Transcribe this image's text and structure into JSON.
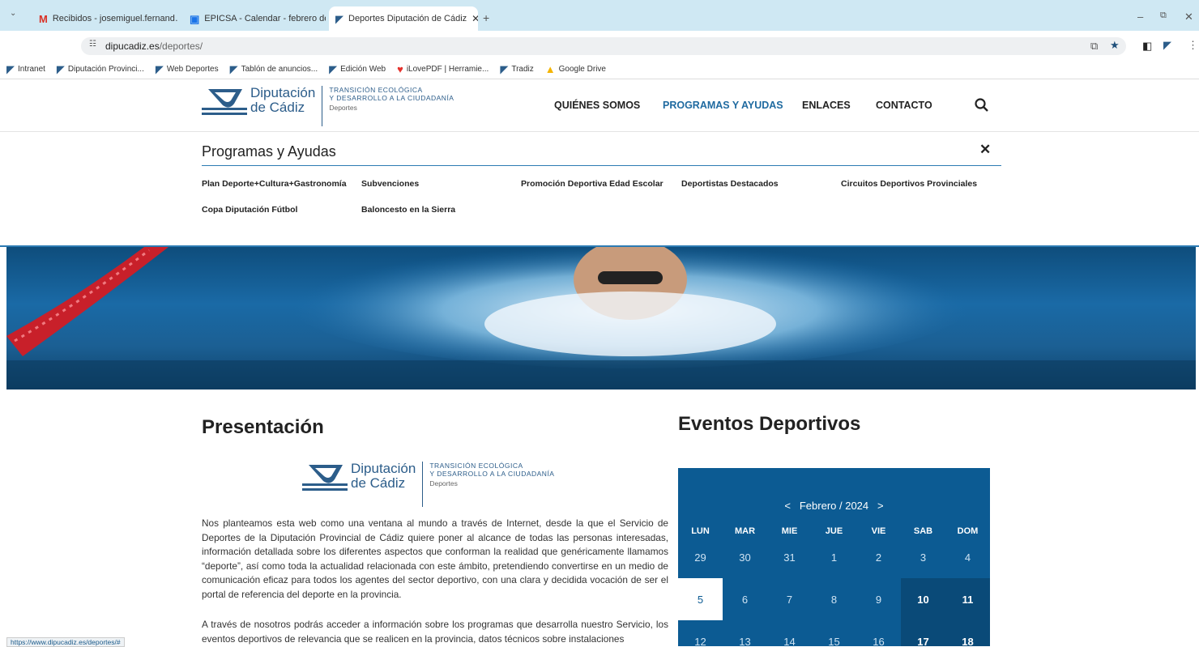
{
  "browser": {
    "tabs": [
      {
        "label": "Recibidos - josemiguel.fernand…",
        "icon": "gmail-icon"
      },
      {
        "label": "EPICSA - Calendar - febrero de",
        "icon": "calendar-icon"
      },
      {
        "label": "Deportes Diputación de Cádiz",
        "icon": "diputacion-icon"
      }
    ],
    "address": {
      "domain": "dipucadiz.es",
      "path": "/deportes/"
    },
    "bookmarks": [
      "Intranet",
      "Diputación Provinci...",
      "Web Deportes",
      "Tablón de anuncios...",
      "Edición Web",
      "iLovePDF | Herramie...",
      "Tradiz",
      "Google Drive"
    ],
    "status_url": "https://www.dipucadiz.es/deportes/#"
  },
  "header": {
    "logo_name": [
      "Diputación",
      "de Cádiz"
    ],
    "logo_sub": [
      "TRANSICIÓN ECOLÓGICA",
      "Y DESARROLLO A LA CIUDADANÍA"
    ],
    "logo_dept": "Deportes",
    "menu": [
      "QUIÉNES SOMOS",
      "PROGRAMAS Y AYUDAS",
      "ENLACES",
      "CONTACTO"
    ]
  },
  "dropdown": {
    "title": "Programas y Ayudas",
    "close": "✕",
    "links": [
      "Plan Deporte+Cultura+Gastronomía",
      "Subvenciones",
      "Promoción Deportiva Edad Escolar",
      "Deportistas Destacados",
      "Circuitos Deportivos Provinciales",
      "Copa Diputación Fútbol",
      "Baloncesto en la Sierra"
    ]
  },
  "presentacion": {
    "title": "Presentación",
    "p1": "Nos planteamos esta web como una ventana al mundo a través de Internet, desde la que el Servicio de Deportes de la Diputación Provincial de Cádiz quiere poner al alcance de todas las personas interesadas, información detallada sobre los diferentes aspectos que conforman la realidad que genéricamente llamamos “deporte”, así como toda la actualidad relacionada con este ámbito, pretendiendo convertirse en un medio de comunicación eficaz para todos los agentes del sector deportivo, con una clara y decidida vocación de ser el portal de referencia del deporte en la provincia.",
    "p2": "A través de nosotros podrás acceder a información sobre los programas que desarrolla nuestro Servicio, los eventos deportivos de relevancia que se realicen en la provincia, datos técnicos sobre instalaciones"
  },
  "eventos": {
    "title": "Eventos Deportivos",
    "month": "Febrero / 2024",
    "prev": "<",
    "next": ">",
    "weekdays": [
      "LUN",
      "MAR",
      "MIE",
      "JUE",
      "VIE",
      "SAB",
      "DOM"
    ],
    "weeks": [
      [
        "29",
        "30",
        "31",
        "1",
        "2",
        "3",
        "4"
      ],
      [
        "5",
        "6",
        "7",
        "8",
        "9",
        "10",
        "11"
      ],
      [
        "12",
        "13",
        "14",
        "15",
        "16",
        "17",
        "18"
      ]
    ],
    "today": "5"
  }
}
